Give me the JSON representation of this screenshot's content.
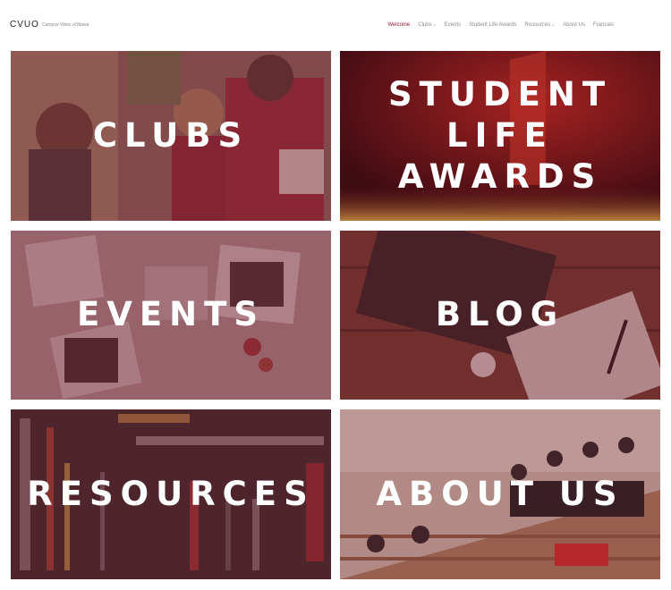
{
  "header": {
    "logo": "CVUO",
    "tagline": "Campus Vibes uOttawa",
    "nav": [
      {
        "label": "Welcome",
        "active": true,
        "dropdown": false
      },
      {
        "label": "Clubs",
        "active": false,
        "dropdown": true
      },
      {
        "label": "Events",
        "active": false,
        "dropdown": false
      },
      {
        "label": "Student Life Awards",
        "active": false,
        "dropdown": false
      },
      {
        "label": "Resources",
        "active": false,
        "dropdown": true
      },
      {
        "label": "About Us",
        "active": false,
        "dropdown": false
      },
      {
        "label": "Francais",
        "active": false,
        "dropdown": false
      }
    ]
  },
  "tiles": [
    {
      "label": "CLUBS"
    },
    {
      "label": "STUDENT\nLIFE\nAWARDS"
    },
    {
      "label": "EVENTS"
    },
    {
      "label": "BLOG"
    },
    {
      "label": "RESOURCES"
    },
    {
      "label": "ABOUT US"
    }
  ],
  "colors": {
    "accent": "#8f1d2c",
    "overlay": "#7a2a38"
  }
}
